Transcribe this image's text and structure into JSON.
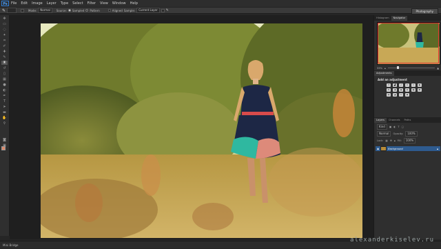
{
  "app": {
    "logo": "Ps"
  },
  "menu": [
    "File",
    "Edit",
    "Image",
    "Layer",
    "Type",
    "Select",
    "Filter",
    "View",
    "Window",
    "Help"
  ],
  "options_bar": {
    "mode_label": "Mode:",
    "mode_value": "Normal",
    "source_label": "Source:",
    "source_sampled": "Sampled",
    "source_pattern": "Pattern",
    "aligned_label": "Aligned",
    "sample_label": "Sample:",
    "sample_value": "Current Layer",
    "workspace": "Photography"
  },
  "navigator": {
    "tabs": [
      "Histogram",
      "Navigator"
    ],
    "active_tab": "Navigator",
    "zoom": "33%"
  },
  "adjustments": {
    "tabs": [
      "Adjustments"
    ],
    "title": "Add an adjustment"
  },
  "layers": {
    "tabs": [
      "Layers",
      "Channels",
      "Paths"
    ],
    "kind_label": "Kind",
    "blend_mode": "Normal",
    "opacity_label": "Opacity:",
    "opacity_value": "100%",
    "lock_label": "Lock:",
    "fill_label": "Fill:",
    "fill_value": "100%",
    "items": [
      {
        "name": "Background"
      }
    ]
  },
  "status": {
    "text": "Mini Bridge"
  },
  "watermark": "alexanderkiselev.ru",
  "colors": {
    "accent": "#2e5b8f",
    "navigator_box": "#e03030",
    "ps_blue": "#2f7ed8"
  }
}
